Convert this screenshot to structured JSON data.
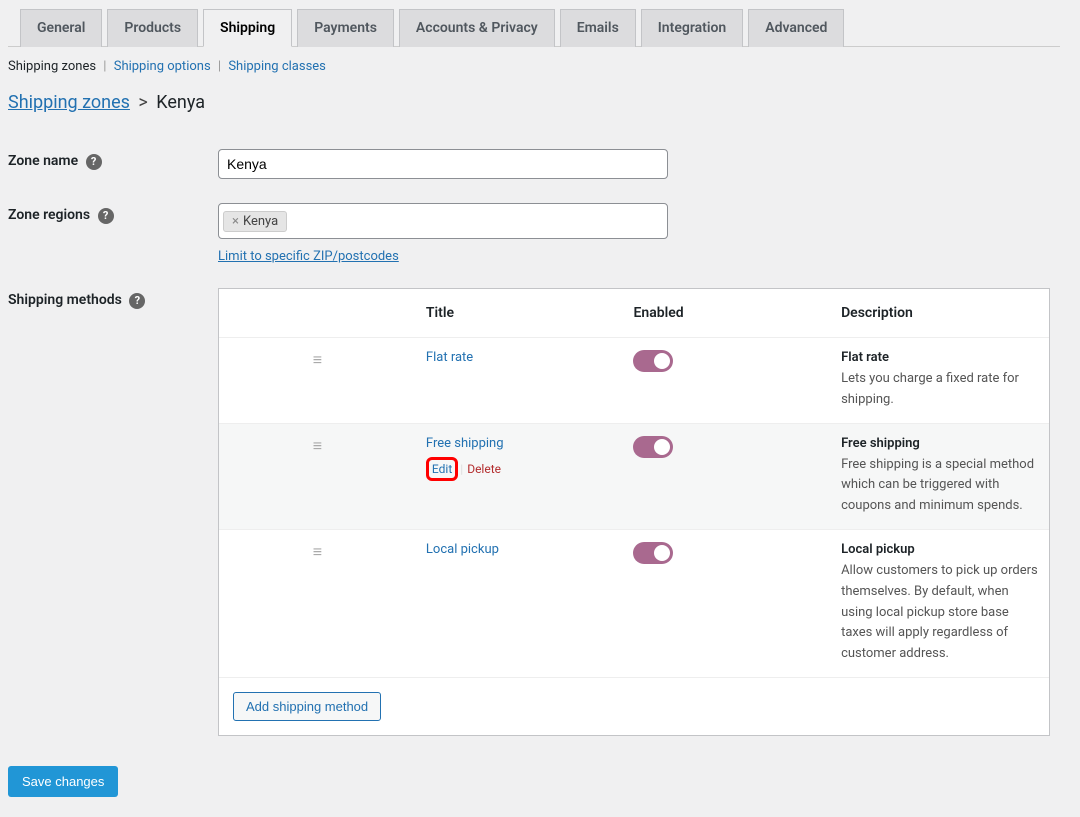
{
  "tabs": [
    "General",
    "Products",
    "Shipping",
    "Payments",
    "Accounts & Privacy",
    "Emails",
    "Integration",
    "Advanced"
  ],
  "active_tab": "Shipping",
  "subnav": {
    "zones": "Shipping zones",
    "options": "Shipping options",
    "classes": "Shipping classes"
  },
  "breadcrumb": {
    "root": "Shipping zones",
    "current": "Kenya"
  },
  "form": {
    "zone_name_label": "Zone name",
    "zone_name_value": "Kenya",
    "zone_regions_label": "Zone regions",
    "region_tag": "Kenya",
    "limit_link": "Limit to specific ZIP/postcodes",
    "methods_label": "Shipping methods"
  },
  "table": {
    "headers": {
      "title": "Title",
      "enabled": "Enabled",
      "description": "Description"
    },
    "rows": [
      {
        "title": "Flat rate",
        "desc_title": "Flat rate",
        "desc_text": "Lets you charge a fixed rate for shipping."
      },
      {
        "title": "Free shipping",
        "desc_title": "Free shipping",
        "desc_text": "Free shipping is a special method which can be triggered with coupons and minimum spends.",
        "edit": "Edit",
        "delete": "Delete"
      },
      {
        "title": "Local pickup",
        "desc_title": "Local pickup",
        "desc_text": "Allow customers to pick up orders themselves. By default, when using local pickup store base taxes will apply regardless of customer address."
      }
    ],
    "add_button": "Add shipping method"
  },
  "save_button": "Save changes"
}
